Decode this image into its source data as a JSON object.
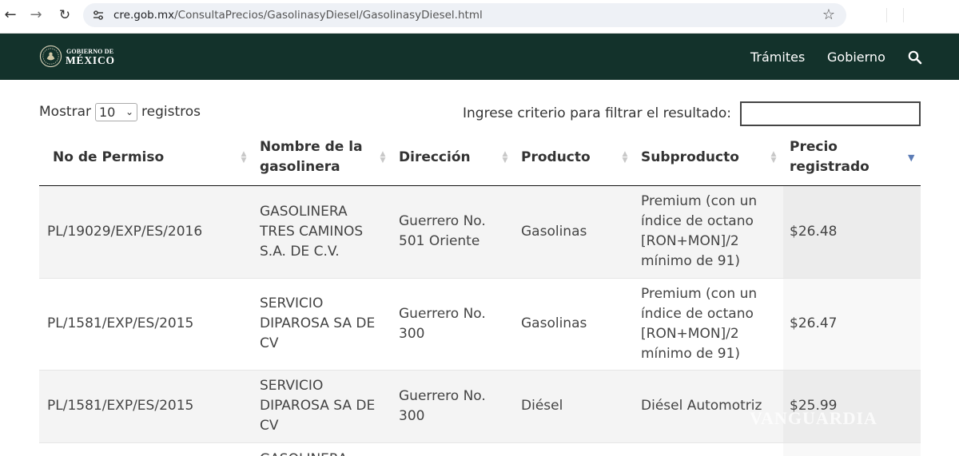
{
  "browser": {
    "url_domain": "cre.gob.mx",
    "url_path": "/ConsultaPrecios/GasolinasyDiesel/GasolinasyDiesel.html",
    "icons": [
      "back-arrow-icon",
      "forward-arrow-icon",
      "reload-icon",
      "site-settings-icon",
      "bookmark-star-icon"
    ]
  },
  "header": {
    "logo_small": "GOBIERNO DE",
    "logo_big": "MÉXICO",
    "nav": [
      "Trámites",
      "Gobierno"
    ],
    "background": "#13322b"
  },
  "controls": {
    "show_label": "Mostrar",
    "page_length": "10",
    "records_label": "registros",
    "filter_label": "Ingrese criterio para filtrar el resultado:",
    "filter_value": ""
  },
  "table": {
    "columns": [
      "No de Permiso",
      "Nombre de la gasolinera",
      "Dirección",
      "Producto",
      "Subproducto",
      "Precio registrado"
    ],
    "sorted_column": "Precio registrado",
    "sort_direction": "desc",
    "rows": [
      [
        "PL/19029/EXP/ES/2016",
        "GASOLINERA TRES CAMINOS S.A. DE C.V.",
        "Guerrero No. 501 Oriente",
        "Gasolinas",
        "Premium (con un índice de octano [RON+MON]/2 mínimo de 91)",
        "$26.48"
      ],
      [
        "PL/1581/EXP/ES/2015",
        "SERVICIO DIPAROSA SA DE CV",
        "Guerrero No. 300",
        "Gasolinas",
        "Premium (con un índice de octano [RON+MON]/2 mínimo de 91)",
        "$26.47"
      ],
      [
        "PL/1581/EXP/ES/2015",
        "SERVICIO DIPAROSA SA DE CV",
        "Guerrero No. 300",
        "Diésel",
        "Diésel Automotriz",
        "$25.99"
      ],
      [
        "",
        "GASOLINERA",
        "",
        "",
        "",
        ""
      ]
    ]
  },
  "watermark": "VANGUARDIA"
}
